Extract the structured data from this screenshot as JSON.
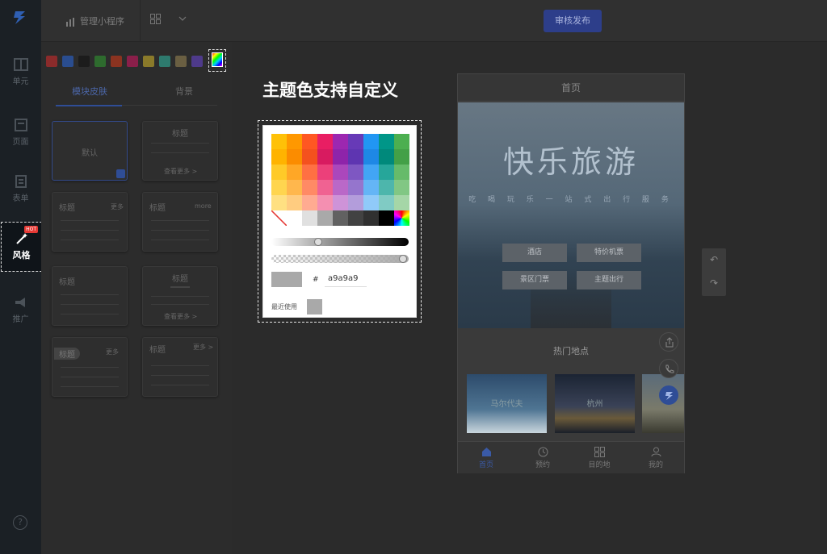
{
  "topbar": {
    "app_label": "管理小程序",
    "review_button": "审核发布"
  },
  "rail": {
    "items": [
      {
        "label": "单元"
      },
      {
        "label": "页面"
      },
      {
        "label": "表单"
      },
      {
        "label": "风格",
        "badge": "HOT"
      },
      {
        "label": "推广"
      }
    ],
    "help": "?"
  },
  "theme": {
    "swatch_colors": [
      "#8b2b2b",
      "#2a4d8f",
      "#1c1c1c",
      "#2e6b2e",
      "#8b3320",
      "#8a1f4a",
      "#8a7a2a",
      "#2e7a6e",
      "#6a5f42",
      "#4e3a8a"
    ]
  },
  "left_tabs": {
    "module_skin": "模块皮肤",
    "background": "背景"
  },
  "templates": [
    {
      "title": "默认"
    },
    {
      "title": "标题",
      "sub": "查看更多 >"
    },
    {
      "title": "标题",
      "tag": "更多"
    },
    {
      "title": "标题",
      "tag": "more"
    },
    {
      "title": "标题"
    },
    {
      "title": "标题",
      "sub": "查看更多 >"
    },
    {
      "title": "标题",
      "tag": "更多"
    },
    {
      "title": "标题",
      "tag": "更多 >"
    }
  ],
  "headline": "主题色支持自定义",
  "picker": {
    "hash": "#",
    "hex_value": "a9a9a9",
    "recent_label": "最近使用",
    "current_color": "#a9a9a9"
  },
  "phone": {
    "title": "首页",
    "hero_title": "快乐旅游",
    "hero_sub": "吃 喝 玩 乐 一 站 式 出 行 服 务",
    "pills": [
      "酒店",
      "特价机票",
      "景区门票",
      "主题出行"
    ],
    "section_title": "热门地点",
    "thumbs": [
      "马尔代夫",
      "杭州"
    ],
    "nav": [
      "首页",
      "预约",
      "目的地",
      "我的"
    ]
  }
}
